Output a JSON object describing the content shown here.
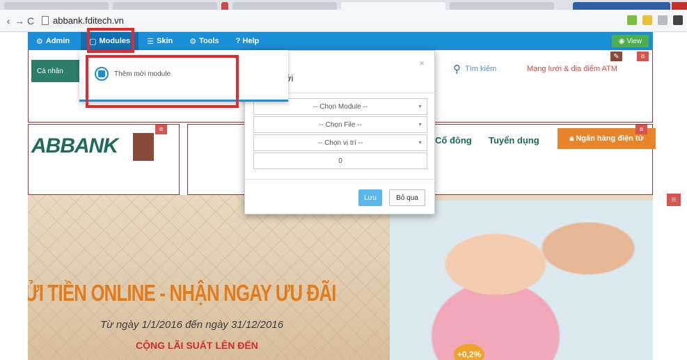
{
  "browser": {
    "url": "abbank.fditech.vn",
    "nav_back": "‹",
    "nav_forward": "→",
    "nav_reload": "C"
  },
  "adminbar": {
    "admin_label": "Admin",
    "modules_label": "Modules",
    "skin_label": "Skin",
    "tools_label": "Tools",
    "help_label": "? Help",
    "view_label": "View"
  },
  "dropdown": {
    "item_label": "Thêm mới module"
  },
  "site": {
    "personal_label": "Cá nhân",
    "search_label": "Tìm kiếm",
    "atm_label": "Mạng lưới & địa điểm ATM",
    "logo_text": "ABBANK",
    "shareholders_label": "Cổ đông",
    "recruitment_label": "Tuyển dụng",
    "ebank_label": "Ngân hàng điện tử"
  },
  "modal": {
    "title_fragment": "ới",
    "close_glyph": "×",
    "module_select": "-- Chọn Module --",
    "file_select": "-- Chọn File --",
    "position_select": "-- Chọn vị trí --",
    "order_value": "0",
    "save_label": "Lưu",
    "skip_label": "Bỏ qua"
  },
  "hero": {
    "title": "GỬI TIỀN ONLINE - NHẬN NGAY ƯU ĐÃI",
    "subtitle": "Từ ngày 1/1/2016 đến ngày 31/12/2016",
    "rate_text": "CỘNG LÃI SUẤT LÊN ĐẾN",
    "badge": "+0,2%"
  },
  "colors": {
    "admin_blue": "#1a8ed6",
    "highlight_red": "#e22a2f",
    "bank_green": "#1f6b5a",
    "ebank_orange": "#e8842a"
  }
}
